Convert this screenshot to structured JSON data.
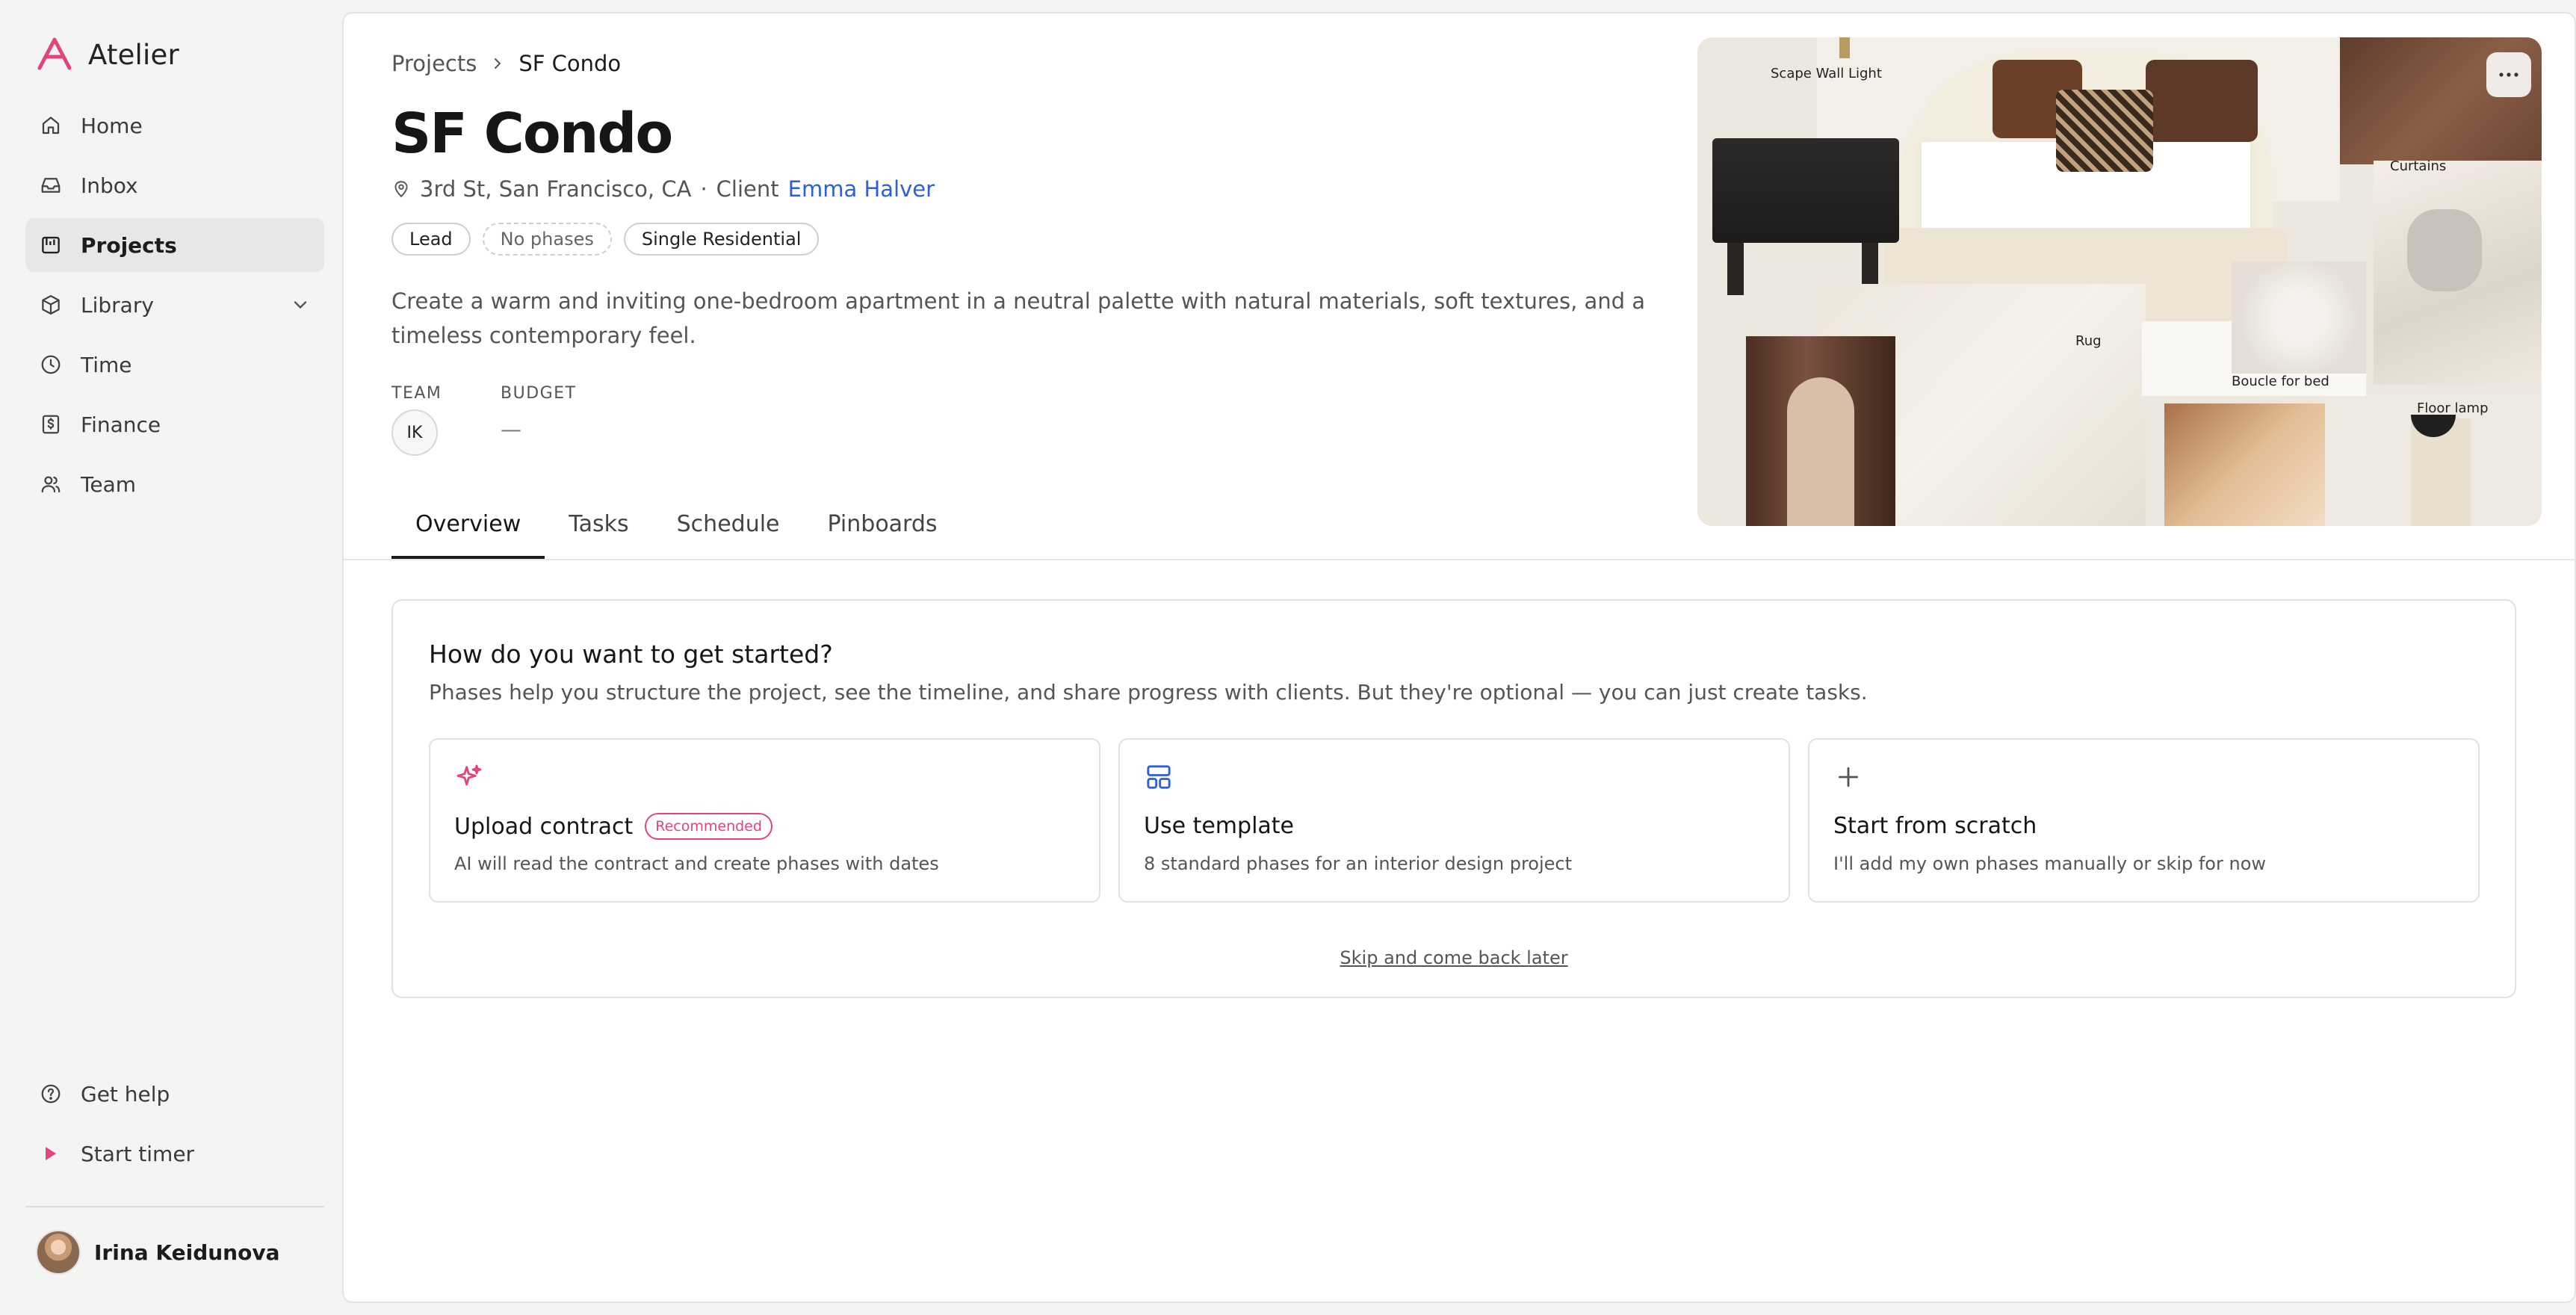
{
  "app": {
    "name": "Atelier",
    "accent": "#e2457a"
  },
  "sidebar": {
    "items": [
      {
        "label": "Home",
        "icon": "home-icon"
      },
      {
        "label": "Inbox",
        "icon": "inbox-icon"
      },
      {
        "label": "Projects",
        "icon": "projects-icon",
        "active": true
      },
      {
        "label": "Library",
        "icon": "library-icon",
        "expandable": true
      },
      {
        "label": "Time",
        "icon": "clock-icon"
      },
      {
        "label": "Finance",
        "icon": "finance-icon"
      },
      {
        "label": "Team",
        "icon": "team-icon"
      }
    ],
    "bottom": {
      "help_label": "Get help",
      "timer_label": "Start timer"
    },
    "user": {
      "name": "Irina Keidunova"
    }
  },
  "project": {
    "breadcrumb": {
      "parent": "Projects",
      "current": "SF Condo"
    },
    "title": "SF Condo",
    "location": "3rd St, San Francisco, CA",
    "separator": "·",
    "client_label": "Client",
    "client_name": "Emma Halver",
    "tags": [
      "Lead",
      "No phases",
      "Single Residential"
    ],
    "description": "Create a warm and inviting one-bedroom apartment in a neutral palette with natural materials, soft textures, and a timeless contemporary feel.",
    "team_label": "TEAM",
    "team_initials": "IK",
    "budget_label": "BUDGET",
    "budget_value": "—"
  },
  "tabs": [
    "Overview",
    "Tasks",
    "Schedule",
    "Pinboards"
  ],
  "moodboard": {
    "labels": [
      "Scape Wall Light",
      "Curtains",
      "Rug",
      "Boucle for bed",
      "Floor lamp"
    ]
  },
  "get_started": {
    "title": "How do you want to get started?",
    "subtitle": "Phases help you structure the project, see the timeline, and share progress with clients. But they're optional — you can just create tasks.",
    "options": [
      {
        "title": "Upload contract",
        "badge": "Recommended",
        "description": "AI will read the contract and create phases with dates",
        "icon": "sparkle-icon"
      },
      {
        "title": "Use template",
        "description": "8 standard phases for an interior design project",
        "icon": "template-icon"
      },
      {
        "title": "Start from scratch",
        "description": "I'll add my own phases manually or skip for now",
        "icon": "plus-icon"
      }
    ],
    "skip_label": "Skip and come back later"
  }
}
